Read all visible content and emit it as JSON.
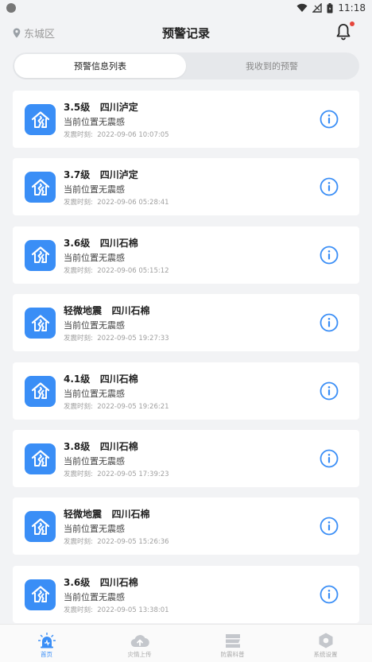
{
  "status_bar": {
    "time": "11:18"
  },
  "header": {
    "location": "东城区",
    "title": "预警记录"
  },
  "tabs": [
    {
      "label": "预警信息列表",
      "active": true
    },
    {
      "label": "我收到的预警",
      "active": false
    }
  ],
  "time_prefix": "发震时刻:",
  "records": [
    {
      "title": "3.5级   四川泸定",
      "status": "当前位置无震感",
      "time": "发震时刻:  2022-09-06 10:07:05"
    },
    {
      "title": "3.7级   四川泸定",
      "status": "当前位置无震感",
      "time": "发震时刻:  2022-09-06 05:28:41"
    },
    {
      "title": "3.6级   四川石棉",
      "status": "当前位置无震感",
      "time": "发震时刻:  2022-09-06 05:15:12"
    },
    {
      "title": "轻微地震   四川石棉",
      "status": "当前位置无震感",
      "time": "发震时刻:  2022-09-05 19:27:33"
    },
    {
      "title": "4.1级   四川石棉",
      "status": "当前位置无震感",
      "time": "发震时刻:  2022-09-05 19:26:21"
    },
    {
      "title": "3.8级   四川石棉",
      "status": "当前位置无震感",
      "time": "发震时刻:  2022-09-05 17:39:23"
    },
    {
      "title": "轻微地震   四川石棉",
      "status": "当前位置无震感",
      "time": "发震时刻:  2022-09-05 15:26:36"
    },
    {
      "title": "3.6级   四川石棉",
      "status": "当前位置无震感",
      "time": "发震时刻:  2022-09-05 13:38:01"
    }
  ],
  "nav": [
    {
      "label": "首页",
      "icon": "alarm-icon",
      "active": true
    },
    {
      "label": "灾情上传",
      "icon": "cloud-upload-icon",
      "active": false
    },
    {
      "label": "防震科普",
      "icon": "book-icon",
      "active": false
    },
    {
      "label": "系统设置",
      "icon": "settings-icon",
      "active": false
    }
  ],
  "colors": {
    "accent": "#3a8ef6",
    "notification_dot": "#e5453b"
  }
}
